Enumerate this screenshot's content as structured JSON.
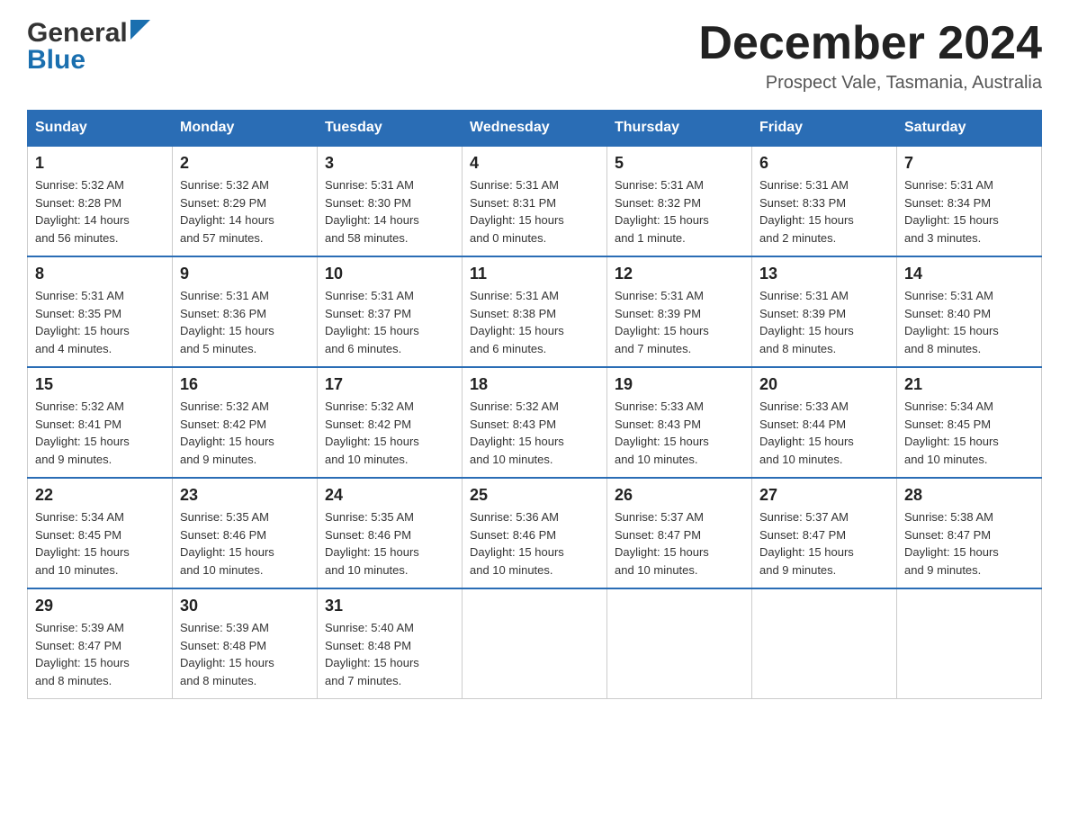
{
  "header": {
    "logo_general": "General",
    "logo_blue": "Blue",
    "month_title": "December 2024",
    "location": "Prospect Vale, Tasmania, Australia"
  },
  "days_of_week": [
    "Sunday",
    "Monday",
    "Tuesday",
    "Wednesday",
    "Thursday",
    "Friday",
    "Saturday"
  ],
  "weeks": [
    [
      {
        "day": "1",
        "sunrise": "5:32 AM",
        "sunset": "8:28 PM",
        "daylight": "14 hours and 56 minutes."
      },
      {
        "day": "2",
        "sunrise": "5:32 AM",
        "sunset": "8:29 PM",
        "daylight": "14 hours and 57 minutes."
      },
      {
        "day": "3",
        "sunrise": "5:31 AM",
        "sunset": "8:30 PM",
        "daylight": "14 hours and 58 minutes."
      },
      {
        "day": "4",
        "sunrise": "5:31 AM",
        "sunset": "8:31 PM",
        "daylight": "15 hours and 0 minutes."
      },
      {
        "day": "5",
        "sunrise": "5:31 AM",
        "sunset": "8:32 PM",
        "daylight": "15 hours and 1 minute."
      },
      {
        "day": "6",
        "sunrise": "5:31 AM",
        "sunset": "8:33 PM",
        "daylight": "15 hours and 2 minutes."
      },
      {
        "day": "7",
        "sunrise": "5:31 AM",
        "sunset": "8:34 PM",
        "daylight": "15 hours and 3 minutes."
      }
    ],
    [
      {
        "day": "8",
        "sunrise": "5:31 AM",
        "sunset": "8:35 PM",
        "daylight": "15 hours and 4 minutes."
      },
      {
        "day": "9",
        "sunrise": "5:31 AM",
        "sunset": "8:36 PM",
        "daylight": "15 hours and 5 minutes."
      },
      {
        "day": "10",
        "sunrise": "5:31 AM",
        "sunset": "8:37 PM",
        "daylight": "15 hours and 6 minutes."
      },
      {
        "day": "11",
        "sunrise": "5:31 AM",
        "sunset": "8:38 PM",
        "daylight": "15 hours and 6 minutes."
      },
      {
        "day": "12",
        "sunrise": "5:31 AM",
        "sunset": "8:39 PM",
        "daylight": "15 hours and 7 minutes."
      },
      {
        "day": "13",
        "sunrise": "5:31 AM",
        "sunset": "8:39 PM",
        "daylight": "15 hours and 8 minutes."
      },
      {
        "day": "14",
        "sunrise": "5:31 AM",
        "sunset": "8:40 PM",
        "daylight": "15 hours and 8 minutes."
      }
    ],
    [
      {
        "day": "15",
        "sunrise": "5:32 AM",
        "sunset": "8:41 PM",
        "daylight": "15 hours and 9 minutes."
      },
      {
        "day": "16",
        "sunrise": "5:32 AM",
        "sunset": "8:42 PM",
        "daylight": "15 hours and 9 minutes."
      },
      {
        "day": "17",
        "sunrise": "5:32 AM",
        "sunset": "8:42 PM",
        "daylight": "15 hours and 10 minutes."
      },
      {
        "day": "18",
        "sunrise": "5:32 AM",
        "sunset": "8:43 PM",
        "daylight": "15 hours and 10 minutes."
      },
      {
        "day": "19",
        "sunrise": "5:33 AM",
        "sunset": "8:43 PM",
        "daylight": "15 hours and 10 minutes."
      },
      {
        "day": "20",
        "sunrise": "5:33 AM",
        "sunset": "8:44 PM",
        "daylight": "15 hours and 10 minutes."
      },
      {
        "day": "21",
        "sunrise": "5:34 AM",
        "sunset": "8:45 PM",
        "daylight": "15 hours and 10 minutes."
      }
    ],
    [
      {
        "day": "22",
        "sunrise": "5:34 AM",
        "sunset": "8:45 PM",
        "daylight": "15 hours and 10 minutes."
      },
      {
        "day": "23",
        "sunrise": "5:35 AM",
        "sunset": "8:46 PM",
        "daylight": "15 hours and 10 minutes."
      },
      {
        "day": "24",
        "sunrise": "5:35 AM",
        "sunset": "8:46 PM",
        "daylight": "15 hours and 10 minutes."
      },
      {
        "day": "25",
        "sunrise": "5:36 AM",
        "sunset": "8:46 PM",
        "daylight": "15 hours and 10 minutes."
      },
      {
        "day": "26",
        "sunrise": "5:37 AM",
        "sunset": "8:47 PM",
        "daylight": "15 hours and 10 minutes."
      },
      {
        "day": "27",
        "sunrise": "5:37 AM",
        "sunset": "8:47 PM",
        "daylight": "15 hours and 9 minutes."
      },
      {
        "day": "28",
        "sunrise": "5:38 AM",
        "sunset": "8:47 PM",
        "daylight": "15 hours and 9 minutes."
      }
    ],
    [
      {
        "day": "29",
        "sunrise": "5:39 AM",
        "sunset": "8:47 PM",
        "daylight": "15 hours and 8 minutes."
      },
      {
        "day": "30",
        "sunrise": "5:39 AM",
        "sunset": "8:48 PM",
        "daylight": "15 hours and 8 minutes."
      },
      {
        "day": "31",
        "sunrise": "5:40 AM",
        "sunset": "8:48 PM",
        "daylight": "15 hours and 7 minutes."
      },
      null,
      null,
      null,
      null
    ]
  ],
  "labels": {
    "sunrise": "Sunrise:",
    "sunset": "Sunset:",
    "daylight": "Daylight:"
  }
}
